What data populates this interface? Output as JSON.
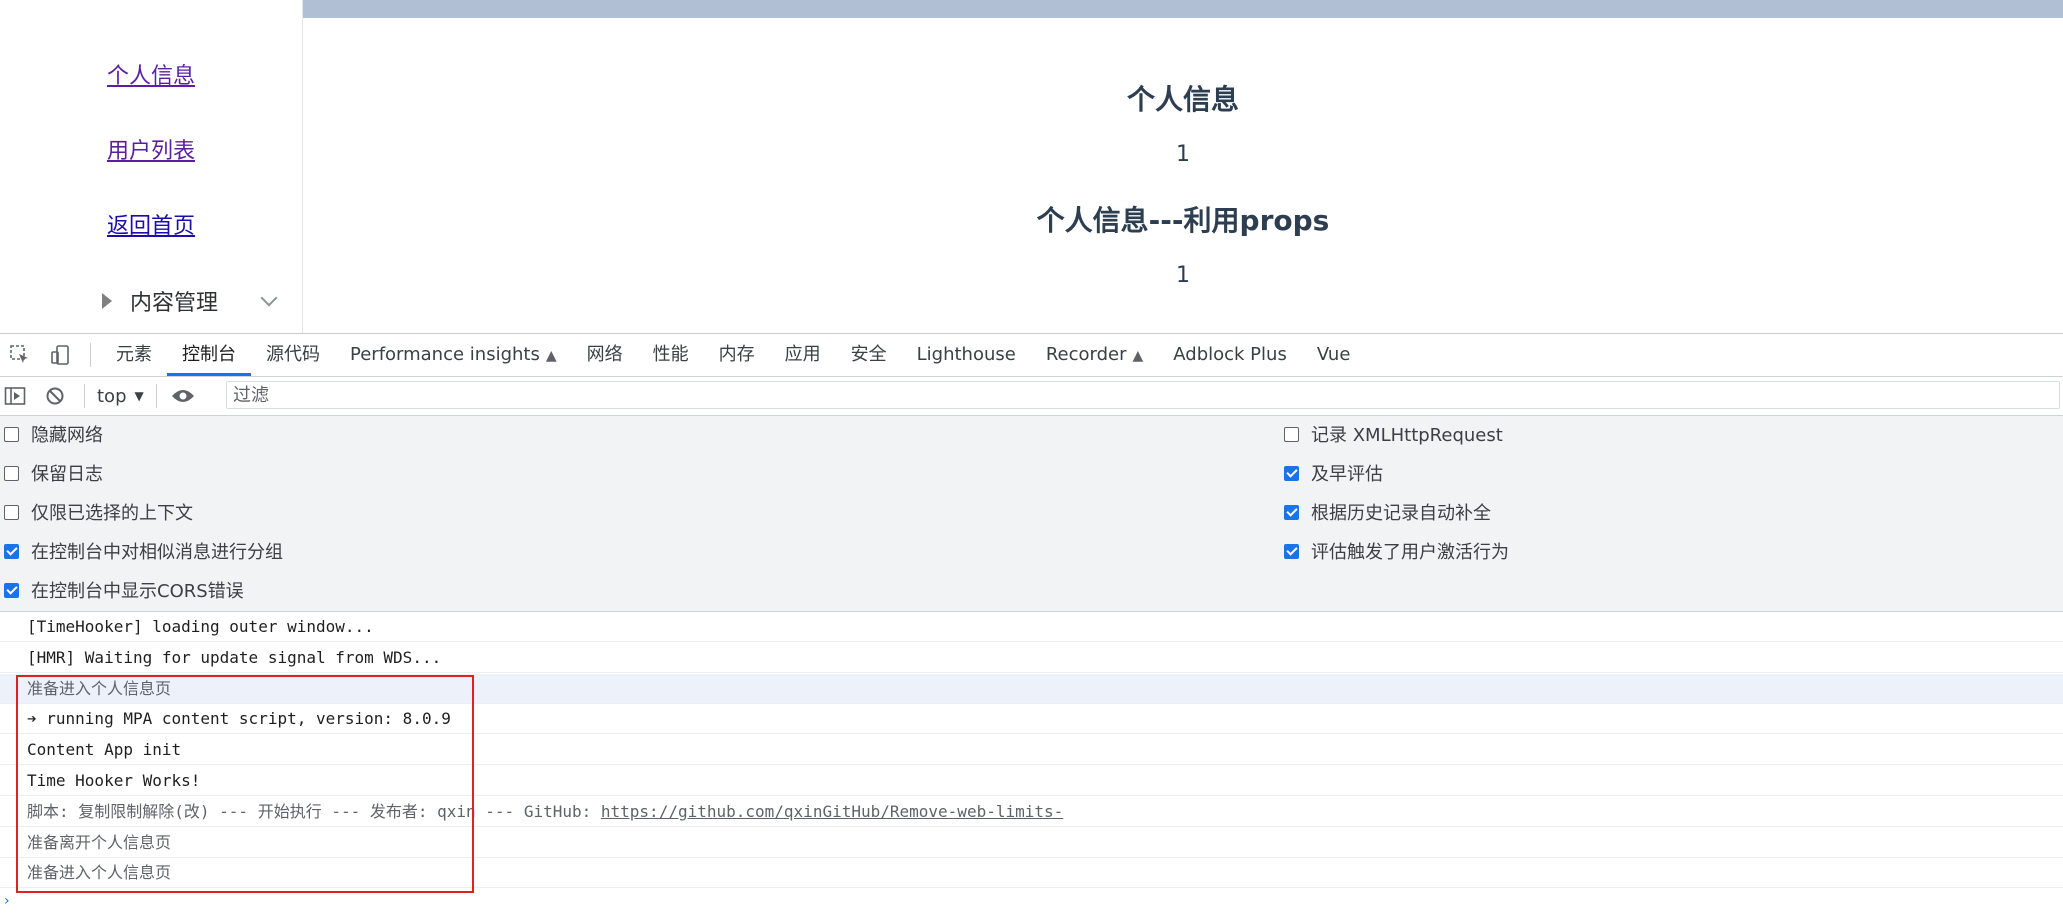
{
  "sidebar": {
    "links": [
      "个人信息",
      "用户列表",
      "返回首页"
    ],
    "submenu_label": "内容管理"
  },
  "main": {
    "heading1": "个人信息",
    "value1": "1",
    "heading2": "个人信息---利用props",
    "value2": "1"
  },
  "devtools": {
    "tabs": [
      "元素",
      "控制台",
      "源代码",
      "Performance insights",
      "网络",
      "性能",
      "内存",
      "应用",
      "安全",
      "Lighthouse",
      "Recorder",
      "Adblock Plus",
      "Vue"
    ],
    "active_tab": "控制台",
    "context": "top",
    "filter_placeholder": "过滤",
    "settings_left": [
      {
        "label": "隐藏网络",
        "checked": false
      },
      {
        "label": "保留日志",
        "checked": false
      },
      {
        "label": "仅限已选择的上下文",
        "checked": false
      },
      {
        "label": "在控制台中对相似消息进行分组",
        "checked": true
      },
      {
        "label": "在控制台中显示CORS错误",
        "checked": true
      }
    ],
    "settings_right": [
      {
        "label": "记录 XMLHttpRequest",
        "checked": false
      },
      {
        "label": "及早评估",
        "checked": true
      },
      {
        "label": "根据历史记录自动补全",
        "checked": true
      },
      {
        "label": "评估触发了用户激活行为",
        "checked": true
      }
    ],
    "console_lines": [
      "[TimeHooker] loading outer window...",
      "[HMR] Waiting for update signal from WDS...",
      "准备进入个人信息页",
      "➔ running MPA content script, version: 8.0.9",
      "Content App init",
      "Time Hooker Works!",
      "脚本: 复制限制解除(改) --- 开始执行 --- 发布者: qxin --- GitHub: ",
      "准备离开个人信息页",
      "准备进入个人信息页"
    ],
    "github_link": "https://github.com/qxinGitHub/Remove-web-limits-",
    "colors": {
      "accent": "#1a73e8",
      "highlight_box": "#e12020",
      "topbar": "#b0bfd3"
    }
  }
}
